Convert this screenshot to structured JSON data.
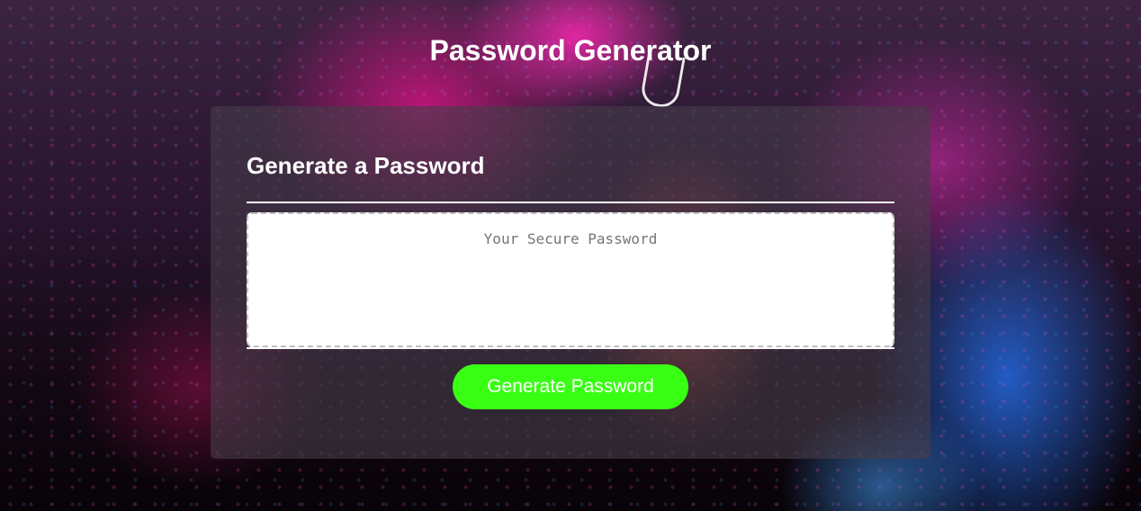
{
  "header": {
    "title": "Password Generator"
  },
  "card": {
    "title": "Generate a Password",
    "password": {
      "value": "",
      "placeholder": "Your Secure Password"
    },
    "generate_button_label": "Generate Password"
  },
  "colors": {
    "card_background": "#463c48",
    "button_background": "#39ff14",
    "button_text": "#ffffff",
    "text": "#ffffff",
    "textarea_border": "#c0c0c0"
  },
  "icons": {
    "background": "neon-bokeh-background-image"
  }
}
